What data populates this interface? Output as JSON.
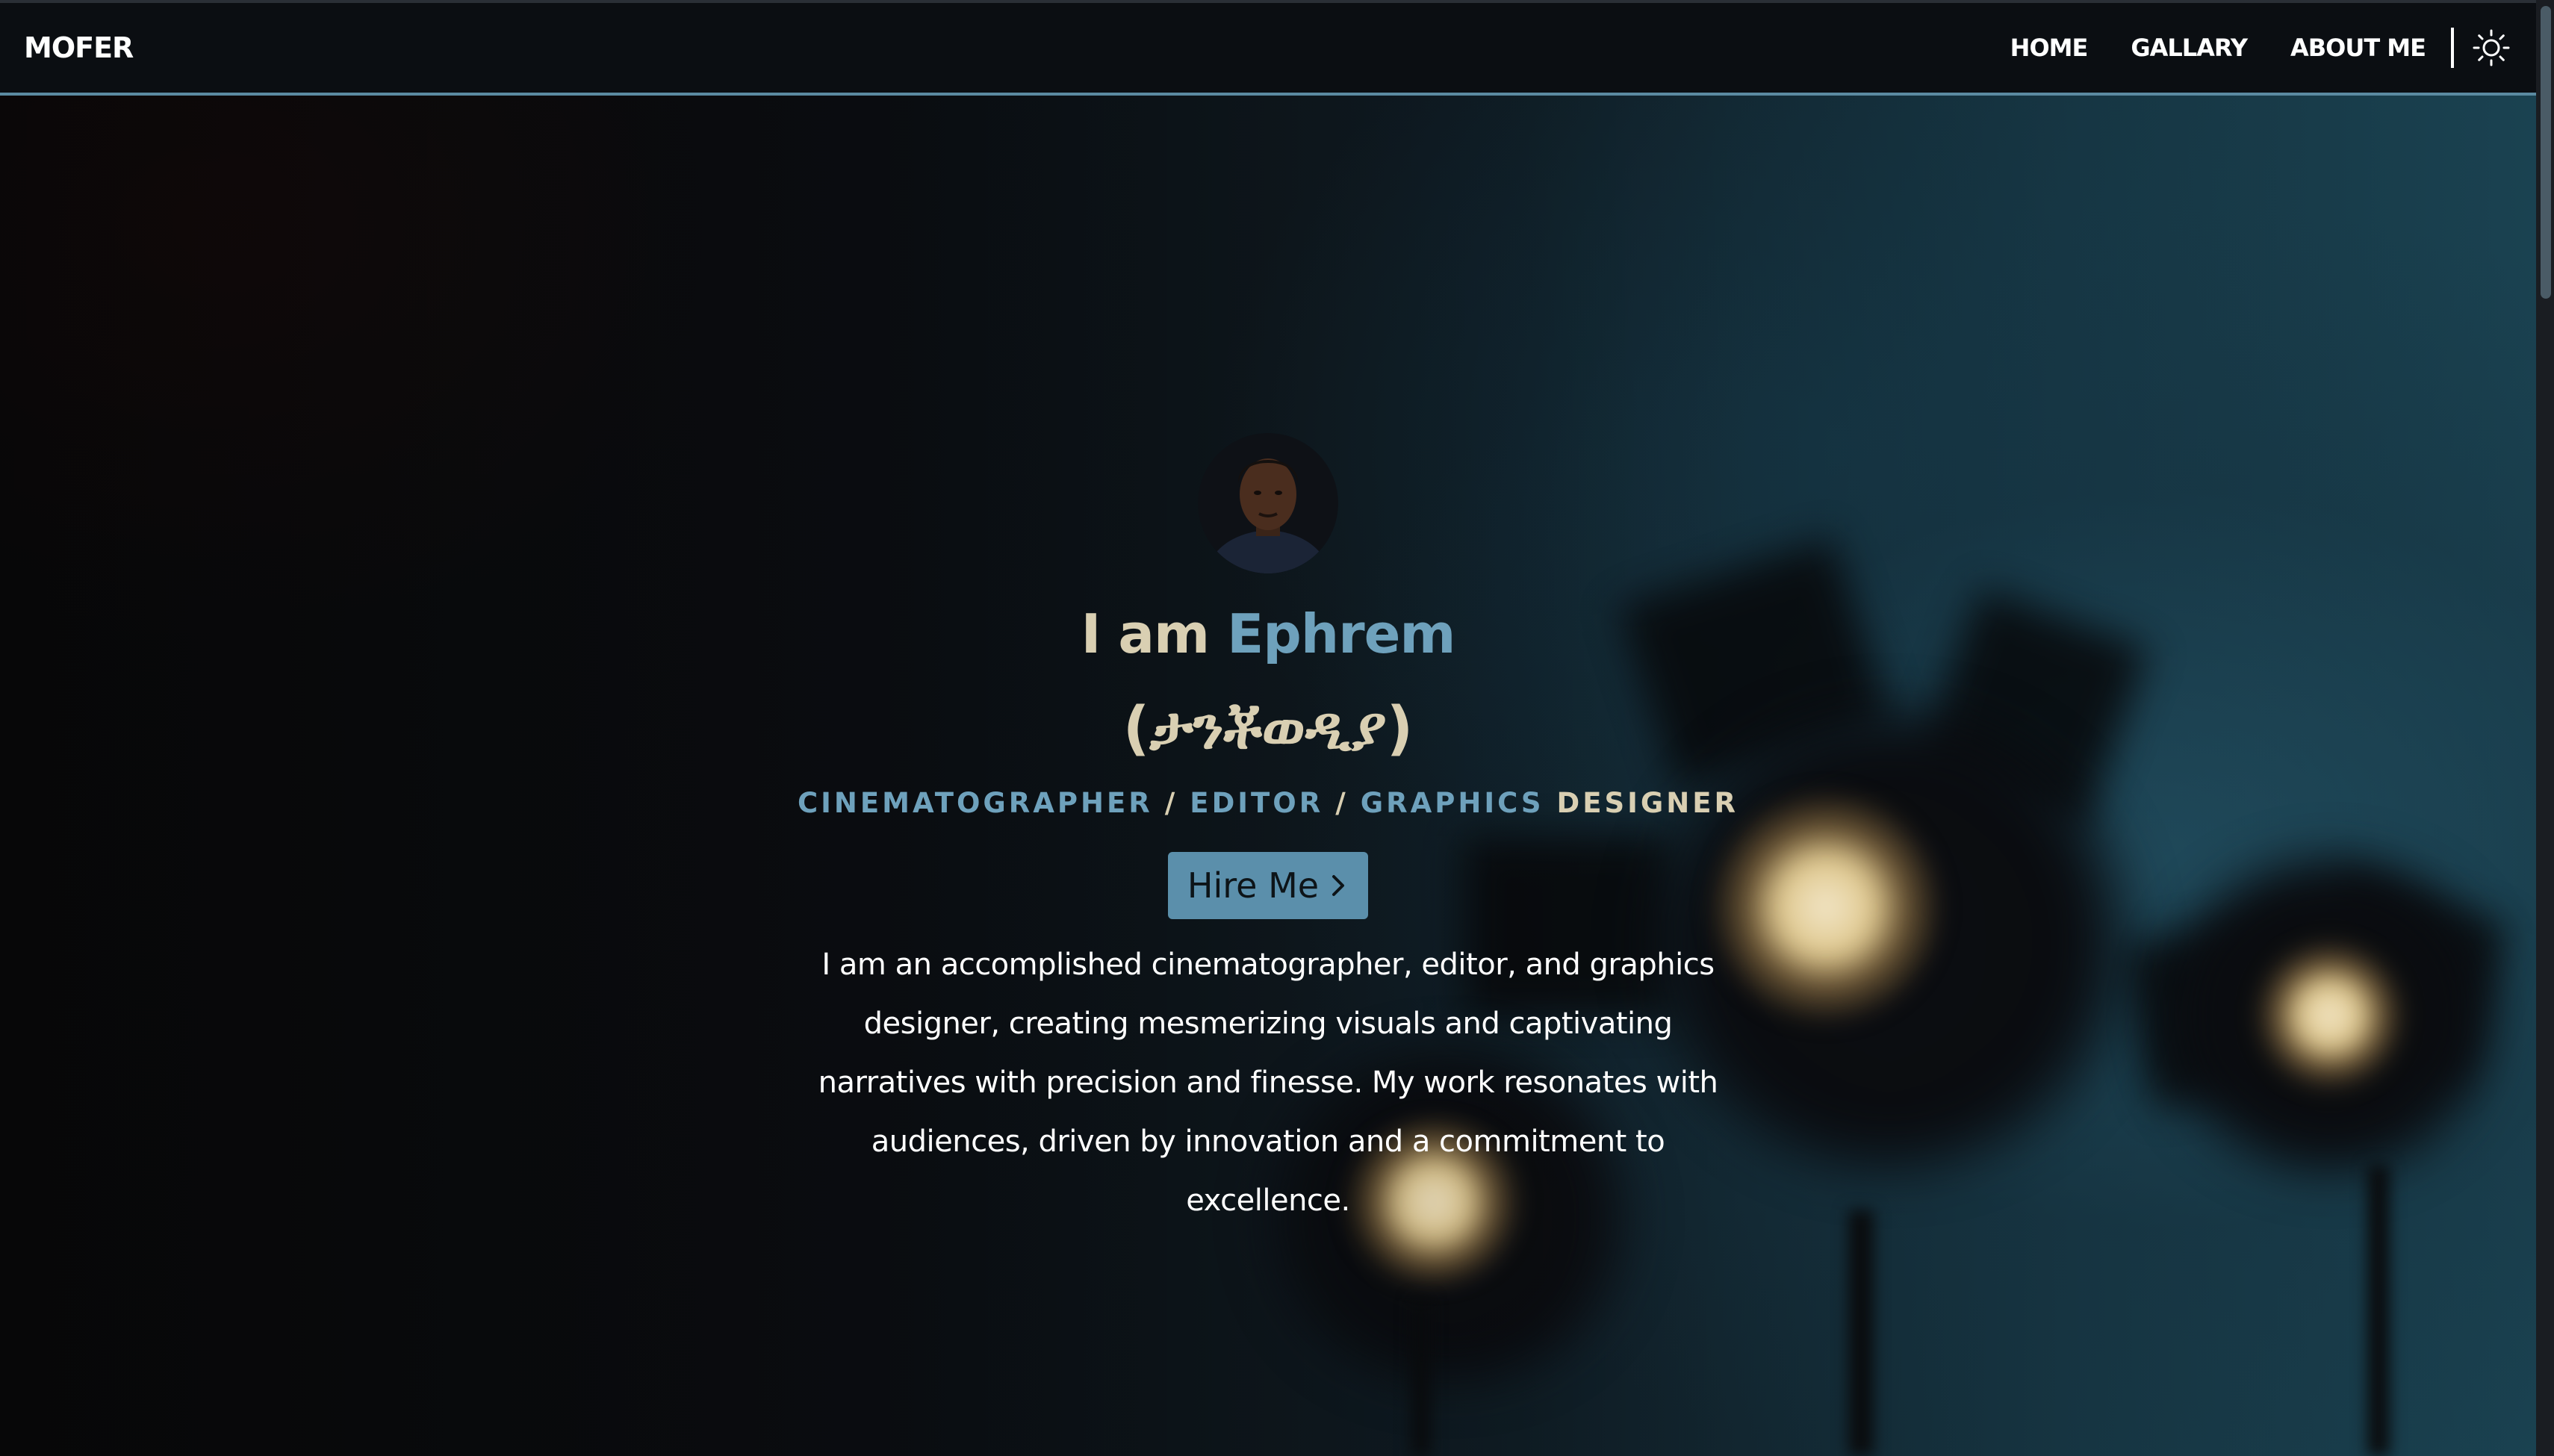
{
  "brand": "MOFER",
  "nav": {
    "links": [
      "HOME",
      "GALLARY",
      "ABOUT ME"
    ],
    "theme_toggle_icon": "sun-icon"
  },
  "hero": {
    "avatar_icon": "avatar",
    "greeting": "I am ",
    "name": "Ephrem",
    "alt_name": "(ታንቾወዲያ)",
    "roles": {
      "role1": "CINEMATOGRAPHER",
      "sep1": "/",
      "role2": "EDITOR",
      "sep2": "/",
      "role3_a": "GRAPHICS",
      "role3_b": "DESIGNER"
    },
    "hire_label": "Hire Me",
    "bio": "I am an accomplished cinematographer, editor, and graphics designer, creating mesmerizing visuals and captivating narratives with precision and finesse. My work resonates with audiences, driven by innovation and a commitment to excellence."
  },
  "colors": {
    "accent": "#6ea1bc",
    "button_bg": "#5b8fab",
    "cream_text": "#d9cfb2",
    "nav_bg": "#0b0e12",
    "nav_border": "#5b8aa1"
  }
}
